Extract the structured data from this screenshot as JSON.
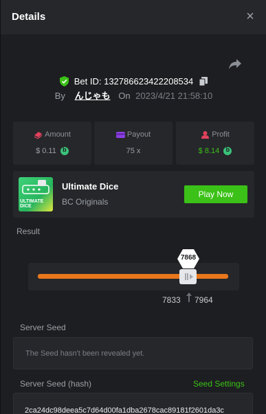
{
  "header": {
    "title": "Details",
    "close_glyph": "×"
  },
  "bet": {
    "id_label": "Bet ID: 132786623422208534",
    "by_label": "By",
    "username": "んじゃも",
    "on_label": "On",
    "timestamp": "2023/4/21 21:58:10"
  },
  "stats": [
    {
      "label": "Amount",
      "value": "$ 0.11",
      "icon": "amount-icon",
      "color": "#e2425d",
      "has_coin": true
    },
    {
      "label": "Payout",
      "value": "75 x",
      "icon": "payout-icon",
      "color": "#8b3fe0",
      "has_coin": false
    },
    {
      "label": "Profit",
      "value": "$ 8.14",
      "icon": "profit-icon",
      "color": "#e2425d",
      "value_color": "#3bc117",
      "has_coin": true
    }
  ],
  "game": {
    "thumb_text": "ULTIMATE DICE",
    "name": "Ultimate Dice",
    "provider": "BC Originals",
    "play_label": "Play Now"
  },
  "result": {
    "label": "Result",
    "value": "7868",
    "range_low": "7833",
    "range_high": "7964",
    "fill_fraction": 0.7868
  },
  "server_seed": {
    "label": "Server Seed",
    "text": "The Seed hasn't been revealed yet."
  },
  "server_seed_hash": {
    "label": "Server Seed (hash)",
    "link": "Seed Settings",
    "value": "2ca24dc98deea5c7d64d00fa1dba2678cac89181f2601da3c"
  },
  "colors": {
    "accent": "#3bc117",
    "track": "#e8771c",
    "background": "#1d1e21"
  }
}
